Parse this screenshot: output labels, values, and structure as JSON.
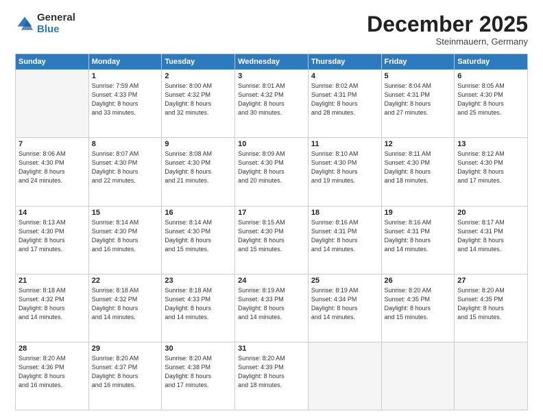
{
  "logo": {
    "general": "General",
    "blue": "Blue"
  },
  "header": {
    "month": "December 2025",
    "location": "Steinmauern, Germany"
  },
  "weekdays": [
    "Sunday",
    "Monday",
    "Tuesday",
    "Wednesday",
    "Thursday",
    "Friday",
    "Saturday"
  ],
  "weeks": [
    [
      {
        "day": "",
        "info": ""
      },
      {
        "day": "1",
        "info": "Sunrise: 7:59 AM\nSunset: 4:33 PM\nDaylight: 8 hours\nand 33 minutes."
      },
      {
        "day": "2",
        "info": "Sunrise: 8:00 AM\nSunset: 4:32 PM\nDaylight: 8 hours\nand 32 minutes."
      },
      {
        "day": "3",
        "info": "Sunrise: 8:01 AM\nSunset: 4:32 PM\nDaylight: 8 hours\nand 30 minutes."
      },
      {
        "day": "4",
        "info": "Sunrise: 8:02 AM\nSunset: 4:31 PM\nDaylight: 8 hours\nand 28 minutes."
      },
      {
        "day": "5",
        "info": "Sunrise: 8:04 AM\nSunset: 4:31 PM\nDaylight: 8 hours\nand 27 minutes."
      },
      {
        "day": "6",
        "info": "Sunrise: 8:05 AM\nSunset: 4:30 PM\nDaylight: 8 hours\nand 25 minutes."
      }
    ],
    [
      {
        "day": "7",
        "info": "Sunrise: 8:06 AM\nSunset: 4:30 PM\nDaylight: 8 hours\nand 24 minutes."
      },
      {
        "day": "8",
        "info": "Sunrise: 8:07 AM\nSunset: 4:30 PM\nDaylight: 8 hours\nand 22 minutes."
      },
      {
        "day": "9",
        "info": "Sunrise: 8:08 AM\nSunset: 4:30 PM\nDaylight: 8 hours\nand 21 minutes."
      },
      {
        "day": "10",
        "info": "Sunrise: 8:09 AM\nSunset: 4:30 PM\nDaylight: 8 hours\nand 20 minutes."
      },
      {
        "day": "11",
        "info": "Sunrise: 8:10 AM\nSunset: 4:30 PM\nDaylight: 8 hours\nand 19 minutes."
      },
      {
        "day": "12",
        "info": "Sunrise: 8:11 AM\nSunset: 4:30 PM\nDaylight: 8 hours\nand 18 minutes."
      },
      {
        "day": "13",
        "info": "Sunrise: 8:12 AM\nSunset: 4:30 PM\nDaylight: 8 hours\nand 17 minutes."
      }
    ],
    [
      {
        "day": "14",
        "info": "Sunrise: 8:13 AM\nSunset: 4:30 PM\nDaylight: 8 hours\nand 17 minutes."
      },
      {
        "day": "15",
        "info": "Sunrise: 8:14 AM\nSunset: 4:30 PM\nDaylight: 8 hours\nand 16 minutes."
      },
      {
        "day": "16",
        "info": "Sunrise: 8:14 AM\nSunset: 4:30 PM\nDaylight: 8 hours\nand 15 minutes."
      },
      {
        "day": "17",
        "info": "Sunrise: 8:15 AM\nSunset: 4:30 PM\nDaylight: 8 hours\nand 15 minutes."
      },
      {
        "day": "18",
        "info": "Sunrise: 8:16 AM\nSunset: 4:31 PM\nDaylight: 8 hours\nand 14 minutes."
      },
      {
        "day": "19",
        "info": "Sunrise: 8:16 AM\nSunset: 4:31 PM\nDaylight: 8 hours\nand 14 minutes."
      },
      {
        "day": "20",
        "info": "Sunrise: 8:17 AM\nSunset: 4:31 PM\nDaylight: 8 hours\nand 14 minutes."
      }
    ],
    [
      {
        "day": "21",
        "info": "Sunrise: 8:18 AM\nSunset: 4:32 PM\nDaylight: 8 hours\nand 14 minutes."
      },
      {
        "day": "22",
        "info": "Sunrise: 8:18 AM\nSunset: 4:32 PM\nDaylight: 8 hours\nand 14 minutes."
      },
      {
        "day": "23",
        "info": "Sunrise: 8:18 AM\nSunset: 4:33 PM\nDaylight: 8 hours\nand 14 minutes."
      },
      {
        "day": "24",
        "info": "Sunrise: 8:19 AM\nSunset: 4:33 PM\nDaylight: 8 hours\nand 14 minutes."
      },
      {
        "day": "25",
        "info": "Sunrise: 8:19 AM\nSunset: 4:34 PM\nDaylight: 8 hours\nand 14 minutes."
      },
      {
        "day": "26",
        "info": "Sunrise: 8:20 AM\nSunset: 4:35 PM\nDaylight: 8 hours\nand 15 minutes."
      },
      {
        "day": "27",
        "info": "Sunrise: 8:20 AM\nSunset: 4:35 PM\nDaylight: 8 hours\nand 15 minutes."
      }
    ],
    [
      {
        "day": "28",
        "info": "Sunrise: 8:20 AM\nSunset: 4:36 PM\nDaylight: 8 hours\nand 16 minutes."
      },
      {
        "day": "29",
        "info": "Sunrise: 8:20 AM\nSunset: 4:37 PM\nDaylight: 8 hours\nand 16 minutes."
      },
      {
        "day": "30",
        "info": "Sunrise: 8:20 AM\nSunset: 4:38 PM\nDaylight: 8 hours\nand 17 minutes."
      },
      {
        "day": "31",
        "info": "Sunrise: 8:20 AM\nSunset: 4:39 PM\nDaylight: 8 hours\nand 18 minutes."
      },
      {
        "day": "",
        "info": ""
      },
      {
        "day": "",
        "info": ""
      },
      {
        "day": "",
        "info": ""
      }
    ]
  ]
}
